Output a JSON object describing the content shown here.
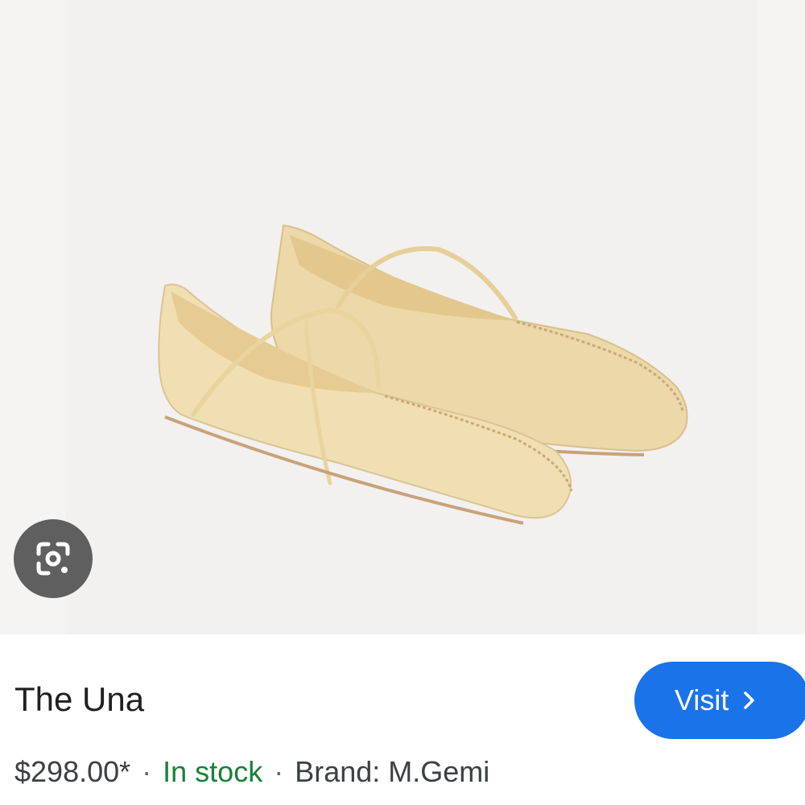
{
  "product": {
    "title": "The Una",
    "price": "$298.00*",
    "availability": "In stock",
    "brand": "Brand: M.Gemi",
    "separator": "·"
  },
  "actions": {
    "visit_label": "Visit",
    "visit_icon": "chevron-right-icon",
    "lens_icon": "google-lens-icon"
  },
  "colors": {
    "accent": "#1a73e8",
    "in_stock": "#188038",
    "lens_button": "#5f5f5f"
  }
}
